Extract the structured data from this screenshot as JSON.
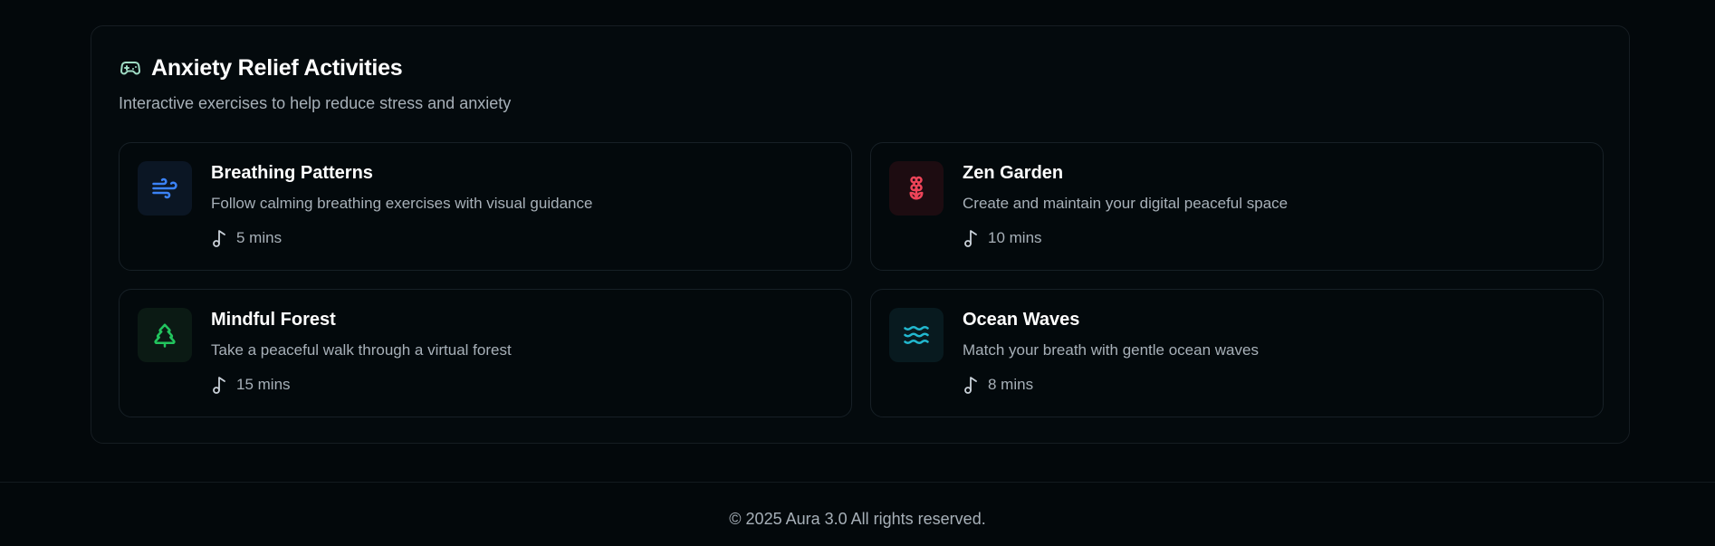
{
  "panel": {
    "title": "Anxiety Relief Activities",
    "subtitle": "Interactive exercises to help reduce stress and anxiety",
    "header_icon": "gamepad-icon"
  },
  "activities": [
    {
      "title": "Breathing Patterns",
      "description": "Follow calming breathing exercises with visual guidance",
      "duration": "5 mins",
      "icon": "wind-icon",
      "accent": "#3b82f6",
      "tile_bg": "#0b1624"
    },
    {
      "title": "Zen Garden",
      "description": "Create and maintain your digital peaceful space",
      "duration": "10 mins",
      "icon": "flower-icon",
      "accent": "#ef4459",
      "tile_bg": "#1d0c11"
    },
    {
      "title": "Mindful Forest",
      "description": "Take a peaceful walk through a virtual forest",
      "duration": "15 mins",
      "icon": "tree-icon",
      "accent": "#22c55e",
      "tile_bg": "#0b1a14"
    },
    {
      "title": "Ocean Waves",
      "description": "Match your breath with gentle ocean waves",
      "duration": "8 mins",
      "icon": "waves-icon",
      "accent": "#22b8cf",
      "tile_bg": "#081a1f"
    }
  ],
  "footer": {
    "text": "© 2025 Aura 3.0 All rights reserved."
  }
}
